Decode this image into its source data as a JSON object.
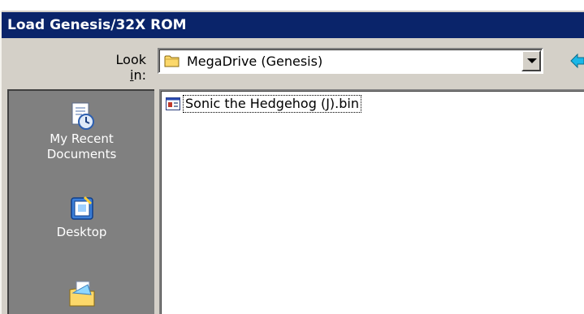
{
  "dialog": {
    "title": "Load Genesis/32X ROM"
  },
  "lookin": {
    "label_prefix": "Look ",
    "label_underline": "i",
    "label_suffix": "n:",
    "value": "MegaDrive (Genesis)",
    "folder_icon": "folder-icon"
  },
  "places": [
    {
      "label": "My Recent Documents",
      "line1": "My Recent",
      "line2": "Documents",
      "icon": "recent-documents-icon"
    },
    {
      "label": "Desktop",
      "line1": "Desktop",
      "line2": "",
      "icon": "desktop-icon"
    },
    {
      "label": "",
      "line1": "",
      "line2": "",
      "icon": "my-documents-icon"
    }
  ],
  "files": [
    {
      "name": "Sonic the Hedgehog (J).bin",
      "icon": "rom-file-icon"
    }
  ],
  "colors": {
    "title_bar": "#0a246a",
    "dialog_face": "#d4d0c8",
    "places_bar": "#808080",
    "back_arrow": "#1ab7e8"
  }
}
